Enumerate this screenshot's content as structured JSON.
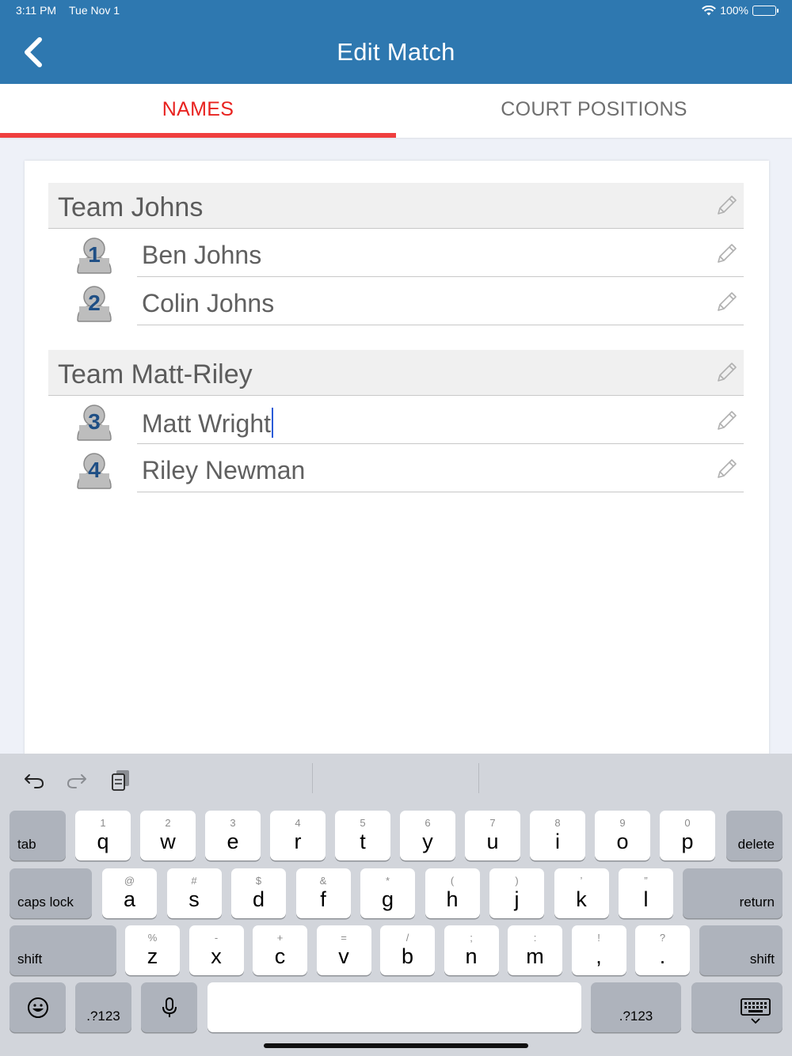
{
  "status_bar": {
    "time": "3:11 PM",
    "date": "Tue Nov 1",
    "battery": "100%"
  },
  "header": {
    "title": "Edit Match",
    "back_icon": "chevron-left-icon"
  },
  "tabs": [
    {
      "label": "NAMES",
      "active": true
    },
    {
      "label": "COURT POSITIONS",
      "active": false
    }
  ],
  "teams": [
    {
      "name": "Team Johns",
      "players": [
        {
          "number": "1",
          "name": "Ben Johns"
        },
        {
          "number": "2",
          "name": "Colin Johns"
        }
      ]
    },
    {
      "name": "Team Matt-Riley",
      "players": [
        {
          "number": "3",
          "name": "Matt Wright"
        },
        {
          "number": "4",
          "name": "Riley Newman"
        }
      ]
    }
  ],
  "colors": {
    "header": "#2e78b0",
    "tab_active": "#e8221f",
    "avatar_number": "#1f4f85"
  },
  "keyboard": {
    "toolbar": [
      "undo-icon",
      "redo-icon",
      "clipboard-icon"
    ],
    "row1": [
      {
        "main": "q",
        "alt": "1"
      },
      {
        "main": "w",
        "alt": "2"
      },
      {
        "main": "e",
        "alt": "3"
      },
      {
        "main": "r",
        "alt": "4"
      },
      {
        "main": "t",
        "alt": "5"
      },
      {
        "main": "y",
        "alt": "6"
      },
      {
        "main": "u",
        "alt": "7"
      },
      {
        "main": "i",
        "alt": "8"
      },
      {
        "main": "o",
        "alt": "9"
      },
      {
        "main": "p",
        "alt": "0"
      }
    ],
    "row2": [
      {
        "main": "a",
        "alt": "@"
      },
      {
        "main": "s",
        "alt": "#"
      },
      {
        "main": "d",
        "alt": "$"
      },
      {
        "main": "f",
        "alt": "&"
      },
      {
        "main": "g",
        "alt": "*"
      },
      {
        "main": "h",
        "alt": "("
      },
      {
        "main": "j",
        "alt": ")"
      },
      {
        "main": "k",
        "alt": "’"
      },
      {
        "main": "l",
        "alt": "”"
      }
    ],
    "row3": [
      {
        "main": "z",
        "alt": "%"
      },
      {
        "main": "x",
        "alt": "-"
      },
      {
        "main": "c",
        "alt": "+"
      },
      {
        "main": "v",
        "alt": "="
      },
      {
        "main": "b",
        "alt": "/"
      },
      {
        "main": "n",
        "alt": ";"
      },
      {
        "main": "m",
        "alt": ":"
      },
      {
        "main": ",",
        "alt": "!"
      },
      {
        "main": ".",
        "alt": "?"
      }
    ],
    "tab": "tab",
    "delete": "delete",
    "caps_lock": "caps lock",
    "return": "return",
    "shift": "shift",
    "numbers": ".?123"
  }
}
